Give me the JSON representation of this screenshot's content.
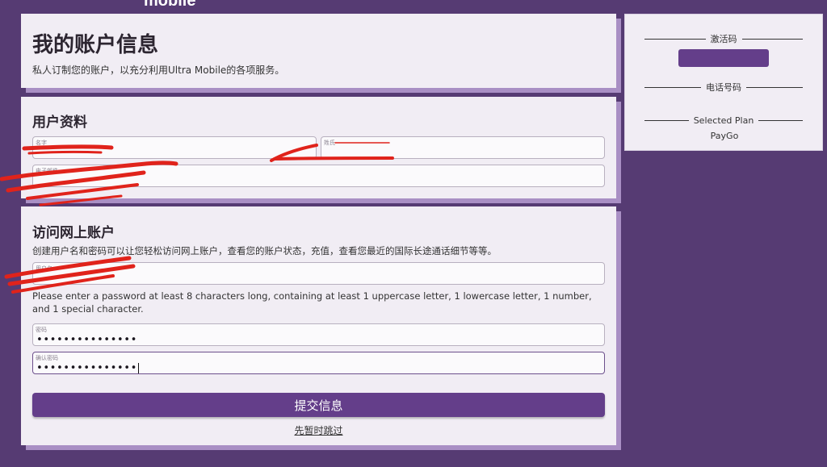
{
  "header": {
    "logo_fragment": "mobile",
    "title": "我的账户信息",
    "subtitle": "私人订制您的账户，以充分利用Ultra Mobile的各项服务。"
  },
  "profile": {
    "section_title": "用户资料",
    "first_name_label": "名字",
    "last_name_label": "姓氏",
    "email_label": "电子邮件"
  },
  "online_account": {
    "section_title": "访问网上账户",
    "description": "创建用户名和密码可以让您轻松访问网上账户，查看您的账户状态，充值，查看您最近的国际长途通话细节等等。",
    "username_label": "用户名",
    "password_hint": "Please enter a password at least 8 characters long, containing at least 1 uppercase letter, 1 lowercase letter, 1 number, and 1 special character.",
    "password_label": "密码",
    "password_value": "•••••••••••••••",
    "confirm_label": "确认密码",
    "confirm_value": "•••••••••••••••",
    "submit_label": "提交信息",
    "skip_label": "先暂时跳过"
  },
  "sidebar": {
    "activation_code_label": "激活码",
    "phone_number_label": "电话号码",
    "selected_plan_label": "Selected Plan",
    "selected_plan_value": "PayGo"
  },
  "colors": {
    "background": "#563b73",
    "card": "#f1edf4",
    "card_shadow": "#a98fc4",
    "accent": "#643e8a",
    "redaction": "#e0231b"
  }
}
